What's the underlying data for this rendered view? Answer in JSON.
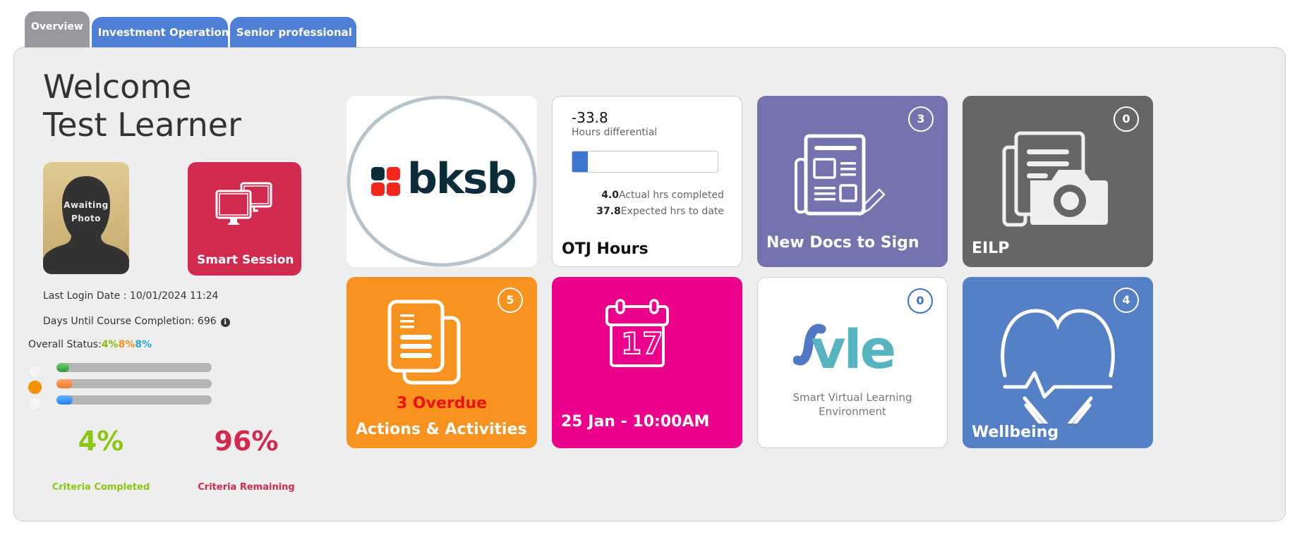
{
  "tabs": [
    {
      "label": "Overview",
      "active": true
    },
    {
      "label": "Investment Operation...",
      "active": false
    },
    {
      "label": "Senior professional ...",
      "active": false
    }
  ],
  "welcome": {
    "line1": "Welcome",
    "line2": "Test Learner"
  },
  "photo": {
    "line1": "Awaiting",
    "line2": "Photo"
  },
  "smart_session": {
    "label": "Smart Session",
    "icon": "monitors-icon"
  },
  "info": {
    "last_login": "Last Login Date : 10/01/2024 11:24",
    "days_until": "Days Until Course Completion: 696",
    "info_icon": "i"
  },
  "overall_status": {
    "label": "Overall Status:",
    "values": [
      "4%",
      "8%",
      "8%"
    ],
    "colors": [
      "#84c10f",
      "#f7931e",
      "#29a8e0"
    ]
  },
  "progress_bars": [
    {
      "color": "green",
      "percent": 4
    },
    {
      "color": "orange",
      "percent": 8
    },
    {
      "color": "blue",
      "percent": 8
    }
  ],
  "status_dots": [
    {
      "active": false
    },
    {
      "active": true
    },
    {
      "active": false
    }
  ],
  "criteria": {
    "completed_pct": "4%",
    "completed_label": "Criteria Completed",
    "remaining_pct": "96%",
    "remaining_label": "Criteria Remaining"
  },
  "tiles": {
    "bksb": {
      "logo_text": "bksb"
    },
    "otj": {
      "differential": "-33.8",
      "differential_label": "Hours differential",
      "progress_fraction": 0.106,
      "actual_value": "4.0",
      "actual_label": "Actual hrs completed",
      "expected_value": "37.8",
      "expected_label": "Expected hrs to date",
      "title": "OTJ Hours"
    },
    "docs": {
      "label": "New Docs to Sign",
      "badge": "3",
      "icon": "document-sign-icon"
    },
    "eilp": {
      "label": "EILP",
      "badge": "0",
      "icon": "document-camera-icon"
    },
    "actions": {
      "overdue": "3 Overdue",
      "label": "Actions & Activities",
      "badge": "5",
      "icon": "documents-icon"
    },
    "calendar": {
      "label": "25 Jan - 10:00AM",
      "day": "17",
      "icon": "calendar-icon"
    },
    "vle": {
      "badge": "0",
      "logo_text": "vle",
      "sub1": "Smart Virtual Learning",
      "sub2": "Environment"
    },
    "wellbeing": {
      "label": "Wellbeing",
      "badge": "4",
      "icon": "heart-pulse-icon"
    }
  }
}
